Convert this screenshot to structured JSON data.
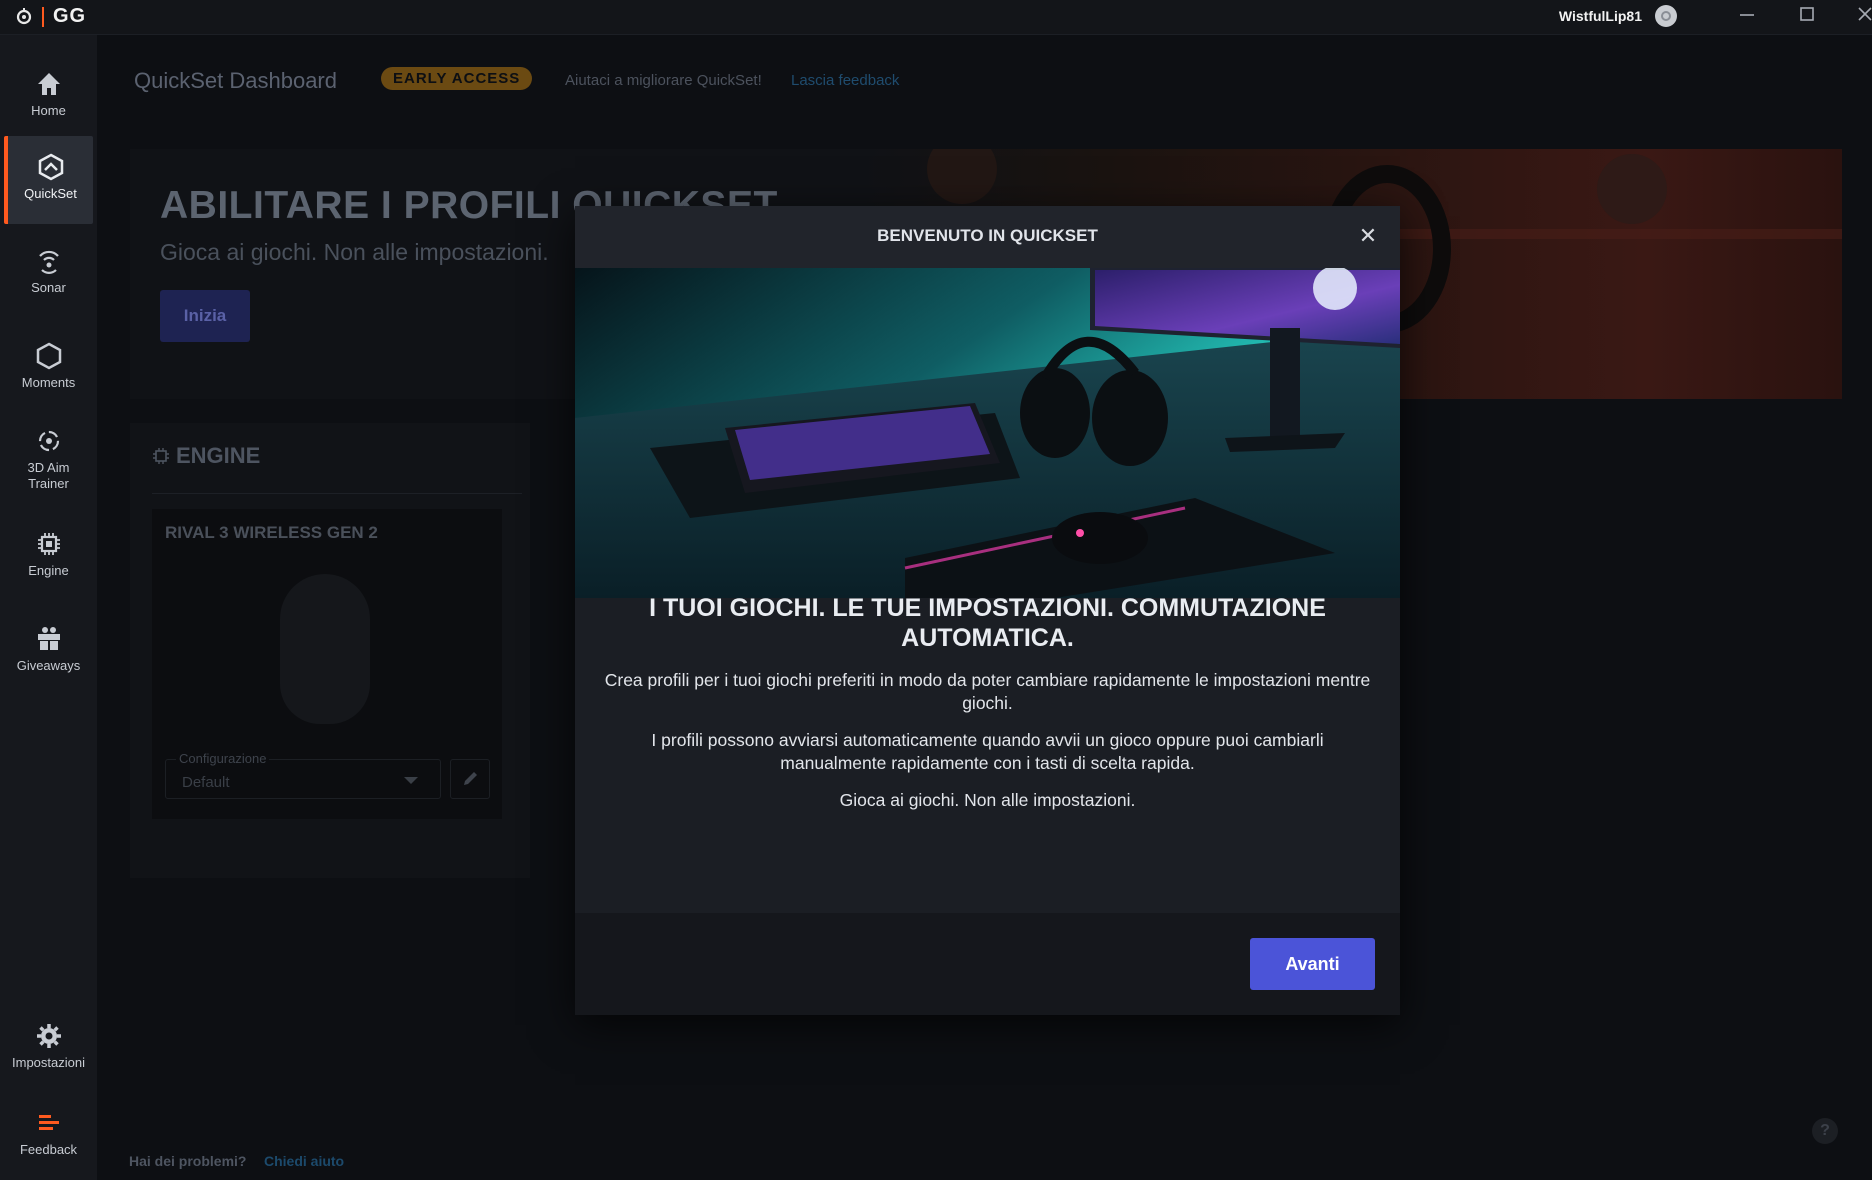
{
  "titlebar": {
    "app_name": "GG",
    "username": "WistfulLip81",
    "logo_icon": "steelseries-logo-icon",
    "controls": [
      "minimize-icon",
      "maximize-icon",
      "close-icon"
    ]
  },
  "sidebar": {
    "items": [
      {
        "label": "Home",
        "icon": "home-icon"
      },
      {
        "label": "QuickSet",
        "icon": "quickset-icon",
        "active": true
      },
      {
        "label": "Sonar",
        "icon": "sonar-icon"
      },
      {
        "label": "Moments",
        "icon": "moments-icon"
      },
      {
        "label": "3D Aim Trainer",
        "icon": "aim-trainer-icon"
      },
      {
        "label": "Engine",
        "icon": "chip-icon"
      },
      {
        "label": "Giveaways",
        "icon": "gift-icon"
      }
    ],
    "bottom_items": [
      {
        "label": "Impostazioni",
        "icon": "gear-icon"
      },
      {
        "label": "Feedback",
        "icon": "feedback-icon"
      }
    ],
    "accent_color": "#ff5a1f"
  },
  "main": {
    "dashboard_title": "QuickSet Dashboard",
    "badge": "EARLY ACCESS",
    "help_text": "Aiutaci a migliorare QuickSet!",
    "help_link": "Lascia feedback",
    "hero": {
      "title": "ABILITARE I PROFILI QUICKSET",
      "subtitle": "Gioca ai giochi. Non alle impostazioni.",
      "button": "Inizia"
    },
    "engine": {
      "title": "ENGINE",
      "device_name": "RIVAL 3 WIRELESS GEN 2",
      "config_label": "Configurazione",
      "config_value": "Default"
    },
    "problems_text": "Hai dei problemi?",
    "problems_link": "Chiedi aiuto"
  },
  "modal": {
    "title": "BENVENUTO IN QUICKSET",
    "heading": "I TUOI GIOCHI. LE TUE IMPOSTAZIONI. COMMUTAZIONE AUTOMATICA.",
    "paragraphs": [
      "Crea profili per i tuoi giochi preferiti in modo da poter cambiare rapidamente le impostazioni mentre giochi.",
      "I profili possono avviarsi automaticamente quando avvii un gioco oppure puoi cambiarli manualmente rapidamente con i tasti di scelta rapida.",
      "Gioca ai giochi. Non alle impostazioni."
    ],
    "next_button": "Avanti",
    "button_color": "#4b54d8"
  }
}
